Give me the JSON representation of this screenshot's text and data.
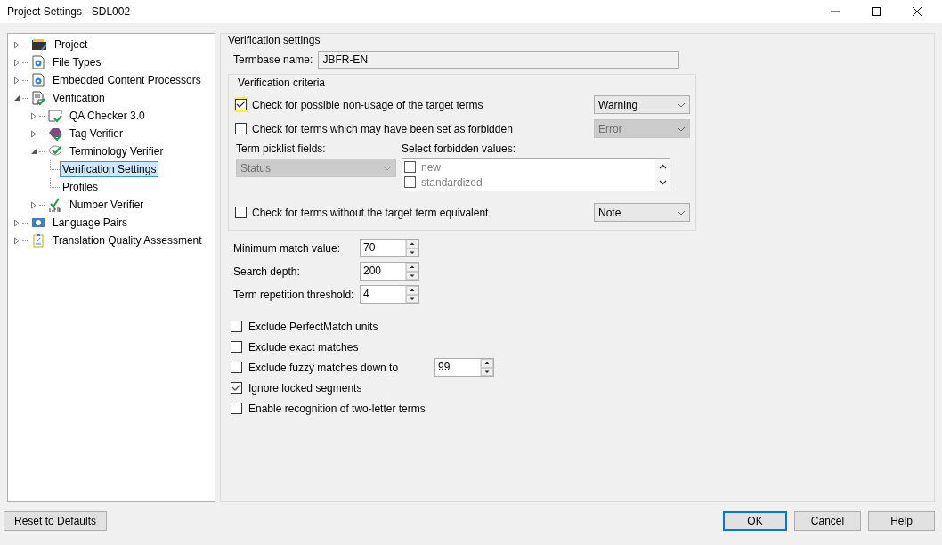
{
  "window": {
    "title": "Project Settings - SDL002"
  },
  "tree": [
    {
      "label": "Project",
      "kind": "project",
      "expanded": false,
      "selected": false
    },
    {
      "label": "File Types",
      "kind": "gear-doc",
      "expanded": false,
      "selected": false
    },
    {
      "label": "Embedded Content Processors",
      "kind": "gear-doc",
      "expanded": false,
      "selected": false
    },
    {
      "label": "Verification",
      "kind": "check-doc",
      "expanded": true,
      "selected": false,
      "children": [
        {
          "label": "QA Checker 3.0",
          "kind": "check-window",
          "expanded": false,
          "selected": false
        },
        {
          "label": "Tag Verifier",
          "kind": "tag",
          "expanded": false,
          "selected": false
        },
        {
          "label": "Terminology Verifier",
          "kind": "check-bubble",
          "expanded": true,
          "selected": false,
          "children": [
            {
              "label": "Verification Settings",
              "kind": "leaf",
              "selected": true
            },
            {
              "label": "Profiles",
              "kind": "leaf",
              "selected": false
            }
          ]
        },
        {
          "label": "Number Verifier",
          "kind": "number",
          "expanded": false,
          "selected": false
        }
      ]
    },
    {
      "label": "Language Pairs",
      "kind": "globe",
      "expanded": false,
      "selected": false
    },
    {
      "label": "Translation Quality Assessment",
      "kind": "clipboard",
      "expanded": false,
      "selected": false
    }
  ],
  "settings": {
    "title": "Verification settings",
    "termbase_label": "Termbase name:",
    "termbase_value": "JBFR-EN",
    "criteria_title": "Verification criteria",
    "criteria": [
      {
        "kind": "check",
        "label": "Check for possible non-usage of the target terms",
        "checked": true,
        "highlighted": true,
        "dropdown": "Warning",
        "disabled": false
      },
      {
        "kind": "check",
        "label": "Check for terms which may have been set as forbidden",
        "checked": false,
        "highlighted": false,
        "dropdown": "Error",
        "disabled": true
      },
      {
        "kind": "picklist",
        "picklist_label": "Term picklist fields:",
        "picklist_value": "Status",
        "disabled": true,
        "values_label": "Select forbidden values:",
        "values": [
          {
            "label": "new",
            "checked": false
          },
          {
            "label": "standardized",
            "checked": false
          }
        ]
      },
      {
        "kind": "check",
        "label": "Check for terms without the target term equivalent",
        "checked": false,
        "highlighted": false,
        "dropdown": "Note",
        "disabled": false
      }
    ],
    "numbers": [
      {
        "label": "Minimum match value:",
        "value": "70"
      },
      {
        "label": "Search depth:",
        "value": "200"
      },
      {
        "label": "Term repetition threshold:",
        "value": "4"
      }
    ],
    "options": [
      {
        "label": "Exclude PerfectMatch units",
        "checked": false
      },
      {
        "label": "Exclude exact matches",
        "checked": false
      },
      {
        "label": "Exclude fuzzy matches down to",
        "checked": false,
        "value": "99"
      },
      {
        "label": "Ignore locked segments",
        "checked": true
      },
      {
        "label": "Enable recognition of two-letter terms",
        "checked": false
      }
    ]
  },
  "buttons": {
    "reset": "Reset to Defaults",
    "ok": "OK",
    "cancel": "Cancel",
    "help": "Help"
  }
}
